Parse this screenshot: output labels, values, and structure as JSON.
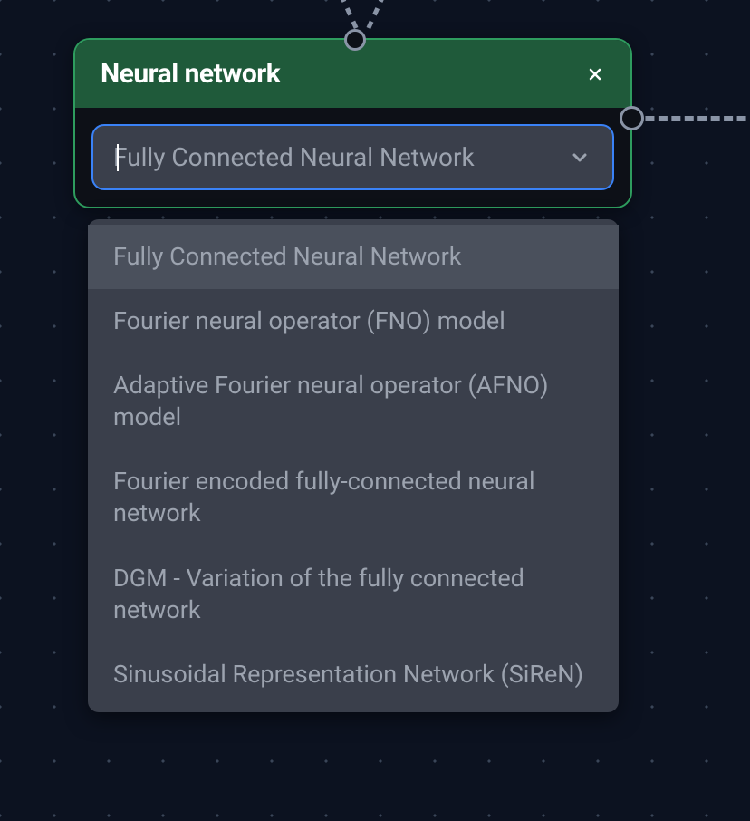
{
  "node": {
    "title": "Neural network"
  },
  "combobox": {
    "placeholder": "Fully Connected Neural Network"
  },
  "dropdown": {
    "options": [
      {
        "label": "Fully Connected Neural Network",
        "highlighted": true
      },
      {
        "label": "Fourier neural operator (FNO) model",
        "highlighted": false
      },
      {
        "label": "Adaptive Fourier neural operator (AFNO) model",
        "highlighted": false
      },
      {
        "label": "Fourier encoded fully-connected neural network",
        "highlighted": false
      },
      {
        "label": "DGM - Variation of the fully connected network",
        "highlighted": false
      },
      {
        "label": "Sinusoidal Representation Network (SiReN)",
        "highlighted": false
      }
    ]
  }
}
